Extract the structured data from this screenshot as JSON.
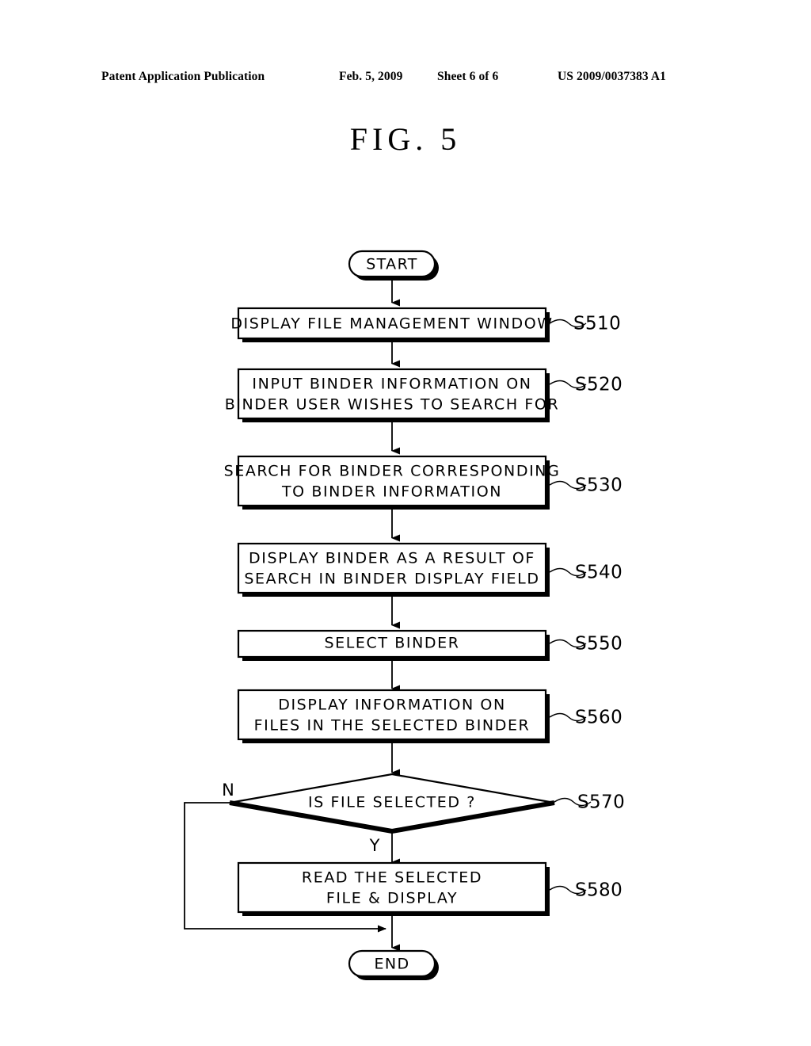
{
  "header": {
    "publication": "Patent Application Publication",
    "date": "Feb. 5, 2009",
    "sheet": "Sheet 6 of 6",
    "patent_number": "US 2009/0037383 A1"
  },
  "figure": {
    "title": "FIG.  5"
  },
  "flowchart": {
    "start_label": "START",
    "end_label": "END",
    "branch_no": "N",
    "branch_yes": "Y",
    "steps": [
      {
        "id": "S510",
        "lines": [
          "DISPLAY FILE MANAGEMENT WINDOW"
        ],
        "ref": "S510",
        "shape": "process"
      },
      {
        "id": "S520",
        "lines": [
          "INPUT BINDER INFORMATION ON",
          "BINDER USER WISHES TO SEARCH FOR"
        ],
        "ref": "S520",
        "shape": "process"
      },
      {
        "id": "S530",
        "lines": [
          "SEARCH FOR BINDER CORRESPONDING",
          "TO BINDER INFORMATION"
        ],
        "ref": "S530",
        "shape": "process"
      },
      {
        "id": "S540",
        "lines": [
          "DISPLAY BINDER AS A RESULT OF",
          "SEARCH IN BINDER DISPLAY FIELD"
        ],
        "ref": "S540",
        "shape": "process"
      },
      {
        "id": "S550",
        "lines": [
          "SELECT BINDER"
        ],
        "ref": "S550",
        "shape": "process"
      },
      {
        "id": "S560",
        "lines": [
          "DISPLAY INFORMATION ON",
          "FILES IN THE SELECTED BINDER"
        ],
        "ref": "S560",
        "shape": "process"
      },
      {
        "id": "S570",
        "lines": [
          "IS FILE SELECTED ?"
        ],
        "ref": "S570",
        "shape": "decision"
      },
      {
        "id": "S580",
        "lines": [
          "READ THE SELECTED",
          "FILE & DISPLAY"
        ],
        "ref": "S580",
        "shape": "process"
      }
    ]
  },
  "colors": {
    "ink": "#000000",
    "paper": "#ffffff"
  }
}
